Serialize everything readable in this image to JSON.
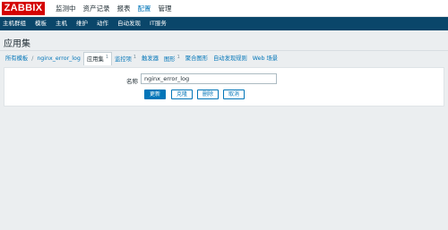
{
  "header": {
    "logo": "ZABBIX",
    "menu": [
      "监测中",
      "资产记录",
      "报表",
      "配置",
      "管理"
    ],
    "active_menu_index": 3
  },
  "submenu": [
    "主机群组",
    "模板",
    "主机",
    "维护",
    "动作",
    "自动发现",
    "IT服务"
  ],
  "page_title": "应用集",
  "breadcrumbs": {
    "all_templates": "所有模板",
    "separator": "/",
    "template": "nginx_error_log",
    "tabs": [
      {
        "label": "应用集",
        "count": "1"
      },
      {
        "label": "监控项",
        "count": "1"
      },
      {
        "label": "触发器",
        "count": ""
      },
      {
        "label": "图形",
        "count": "1"
      },
      {
        "label": "聚合图形",
        "count": ""
      },
      {
        "label": "自动发现规则",
        "count": ""
      },
      {
        "label": "Web 场景",
        "count": ""
      }
    ]
  },
  "form": {
    "name_label": "名称",
    "name_value": "nginx_error_log",
    "buttons": {
      "update": "更新",
      "clone": "克隆",
      "delete": "删除",
      "cancel": "取消"
    }
  },
  "colors": {
    "logo": "#d40000",
    "subbar": "#0a466a",
    "link": "#0275b8",
    "background": "#ebeef0"
  }
}
